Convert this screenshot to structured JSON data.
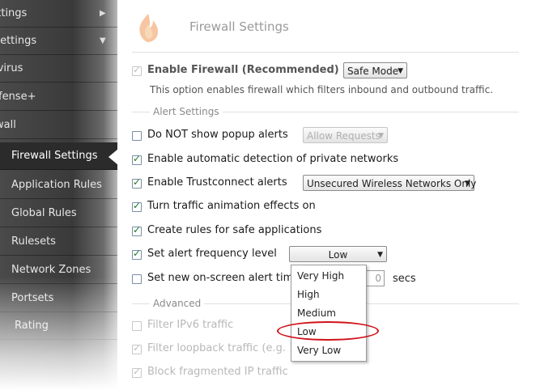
{
  "sidebar": {
    "items": [
      {
        "label": "Settings",
        "arrow": "▶"
      },
      {
        "label": "y Settings",
        "arrow": "▼"
      },
      {
        "label": "tivirus"
      },
      {
        "label": "efense+"
      },
      {
        "label": "ewall"
      },
      {
        "label": "Firewall Settings"
      },
      {
        "label": "Application Rules"
      },
      {
        "label": "Global Rules"
      },
      {
        "label": "Rulesets"
      },
      {
        "label": "Network Zones"
      },
      {
        "label": "Portsets"
      },
      {
        "label": "Rating"
      }
    ]
  },
  "main": {
    "title": "Firewall Settings",
    "enable_firewall": {
      "label": "Enable Firewall (Recommended)",
      "checked": true,
      "mode": "Safe Mode"
    },
    "description": "This option enables firewall which filters inbound and outbound traffic.",
    "alert_section": "Alert Settings",
    "options": [
      {
        "label": "Do NOT show popup alerts",
        "checked": false
      },
      {
        "label": "Enable automatic detection of private networks",
        "checked": true
      },
      {
        "label": "Enable Trustconnect alerts",
        "checked": true
      },
      {
        "label": "Turn traffic animation effects on",
        "checked": true
      },
      {
        "label": "Create rules for safe applications",
        "checked": true
      },
      {
        "label": "Set alert frequency level",
        "checked": true
      },
      {
        "label": "Set new on-screen alert time",
        "checked": false
      }
    ],
    "popup_select": "Allow Requests",
    "trustconnect_select": "Unsecured Wireless Networks Only",
    "frequency_select": "Low",
    "timeout_suffix": "secs",
    "timeout_value": "0",
    "advanced_section": "Advanced",
    "advanced": [
      {
        "label": "Filter IPv6 traffic",
        "checked": false
      },
      {
        "label": "Filter loopback traffic (e.g. 1",
        "checked": true
      },
      {
        "label": "Block fragmented IP traffic",
        "checked": true
      }
    ]
  },
  "frequency_dropdown": {
    "options": [
      "Very High",
      "High",
      "Medium",
      "Low",
      "Very Low"
    ],
    "highlighted": "Low"
  },
  "colors": {
    "sidebar_bg": "#3a3a3a",
    "ring": "#d0141c",
    "check": "#1f7a1f"
  },
  "icons": {
    "title_icon": "flame-icon"
  }
}
